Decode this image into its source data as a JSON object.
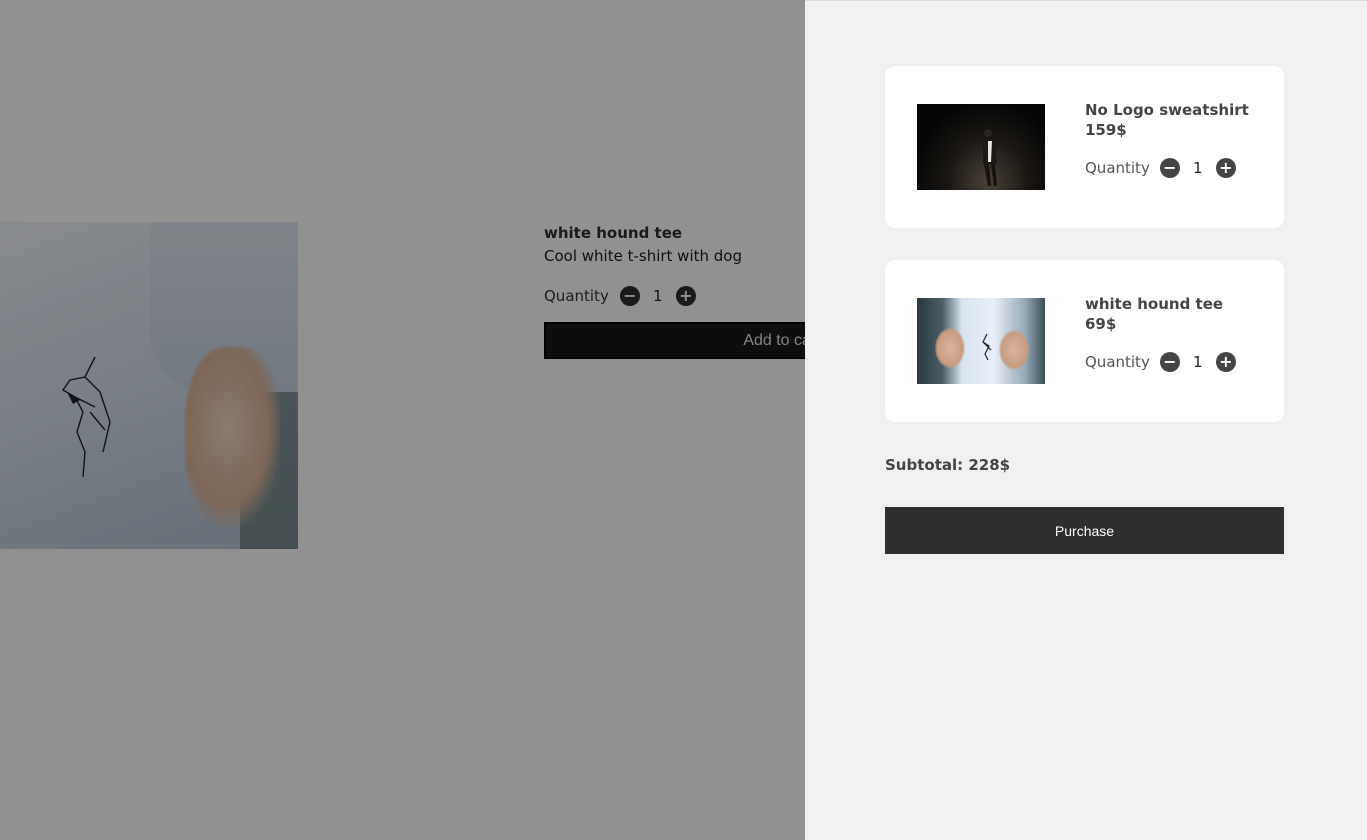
{
  "product": {
    "name": "white hound tee",
    "description": "Cool white t-shirt with dog",
    "quantity_label": "Quantity",
    "quantity": "1",
    "add_to_cart_label": "Add to cart"
  },
  "cart": {
    "items": [
      {
        "name": "No Logo sweatshirt",
        "price": "159$",
        "quantity_label": "Quantity",
        "quantity": "1"
      },
      {
        "name": "white hound tee",
        "price": "69$",
        "quantity_label": "Quantity",
        "quantity": "1"
      }
    ],
    "subtotal": "Subtotal: 228$",
    "purchase_label": "Purchase"
  },
  "icons": {
    "minus": "−",
    "plus": "+"
  },
  "colors": {
    "overlay": "#919191",
    "drawer_bg": "#f0f0f0",
    "button_dark": "#2f2f2f"
  }
}
